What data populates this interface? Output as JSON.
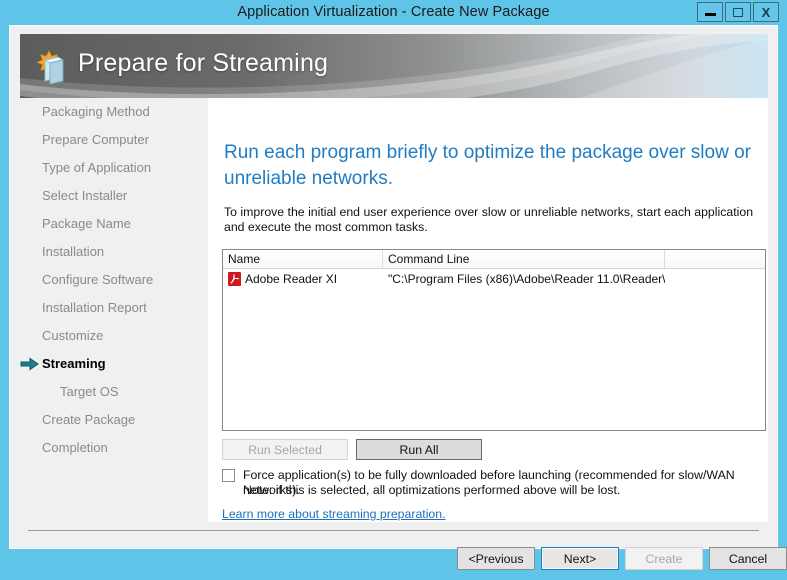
{
  "window": {
    "title": "Application Virtualization - Create New Package",
    "controls": {
      "minimize": "minimize-icon",
      "maximize": "maximize-icon",
      "close": "X"
    }
  },
  "banner": {
    "title": "Prepare for Streaming",
    "icon": "package-star-icon"
  },
  "sidebar": {
    "items": [
      {
        "label": "Packaging Method",
        "state": "done",
        "sub": false
      },
      {
        "label": "Prepare Computer",
        "state": "done",
        "sub": false
      },
      {
        "label": "Type of Application",
        "state": "done",
        "sub": false
      },
      {
        "label": "Select Installer",
        "state": "done",
        "sub": false
      },
      {
        "label": "Package Name",
        "state": "done",
        "sub": false
      },
      {
        "label": "Installation",
        "state": "done",
        "sub": false
      },
      {
        "label": "Configure Software",
        "state": "done",
        "sub": false
      },
      {
        "label": "Installation Report",
        "state": "done",
        "sub": false
      },
      {
        "label": "Customize",
        "state": "done",
        "sub": false
      },
      {
        "label": "Streaming",
        "state": "current",
        "sub": false
      },
      {
        "label": "Target OS",
        "state": "pending",
        "sub": true
      },
      {
        "label": "Create Package",
        "state": "pending",
        "sub": false
      },
      {
        "label": "Completion",
        "state": "pending",
        "sub": false
      }
    ]
  },
  "main": {
    "heading": "Run each program briefly to optimize the package over slow or unreliable networks.",
    "subtext": "To improve the initial end user experience over slow or unreliable networks, start each application and execute the most common tasks.",
    "table": {
      "columns": [
        "Name",
        "Command Line",
        ""
      ],
      "rows": [
        {
          "icon": "adobe-pdf-icon",
          "name": "Adobe Reader XI",
          "command_line": "\"C:\\Program Files (x86)\\Adobe\\Reader 11.0\\Reader\\..."
        }
      ]
    },
    "buttons": {
      "run_selected": "Run Selected",
      "run_all": "Run All"
    },
    "checkbox": {
      "checked": false,
      "label": "Force application(s) to be fully downloaded before launching (recommended for slow/WAN networks).",
      "note": "Note: if this is selected, all optimizations performed above will be lost."
    },
    "link": "Learn more about streaming preparation."
  },
  "footer": {
    "previous": "<Previous",
    "next": "Next>",
    "create": "Create",
    "cancel": "Cancel"
  },
  "colors": {
    "title_bar": "#5fc5e8",
    "heading": "#1f7dc4",
    "link": "#1f6fc0",
    "arrow": "#18808f",
    "pdf": "#d0191f"
  }
}
